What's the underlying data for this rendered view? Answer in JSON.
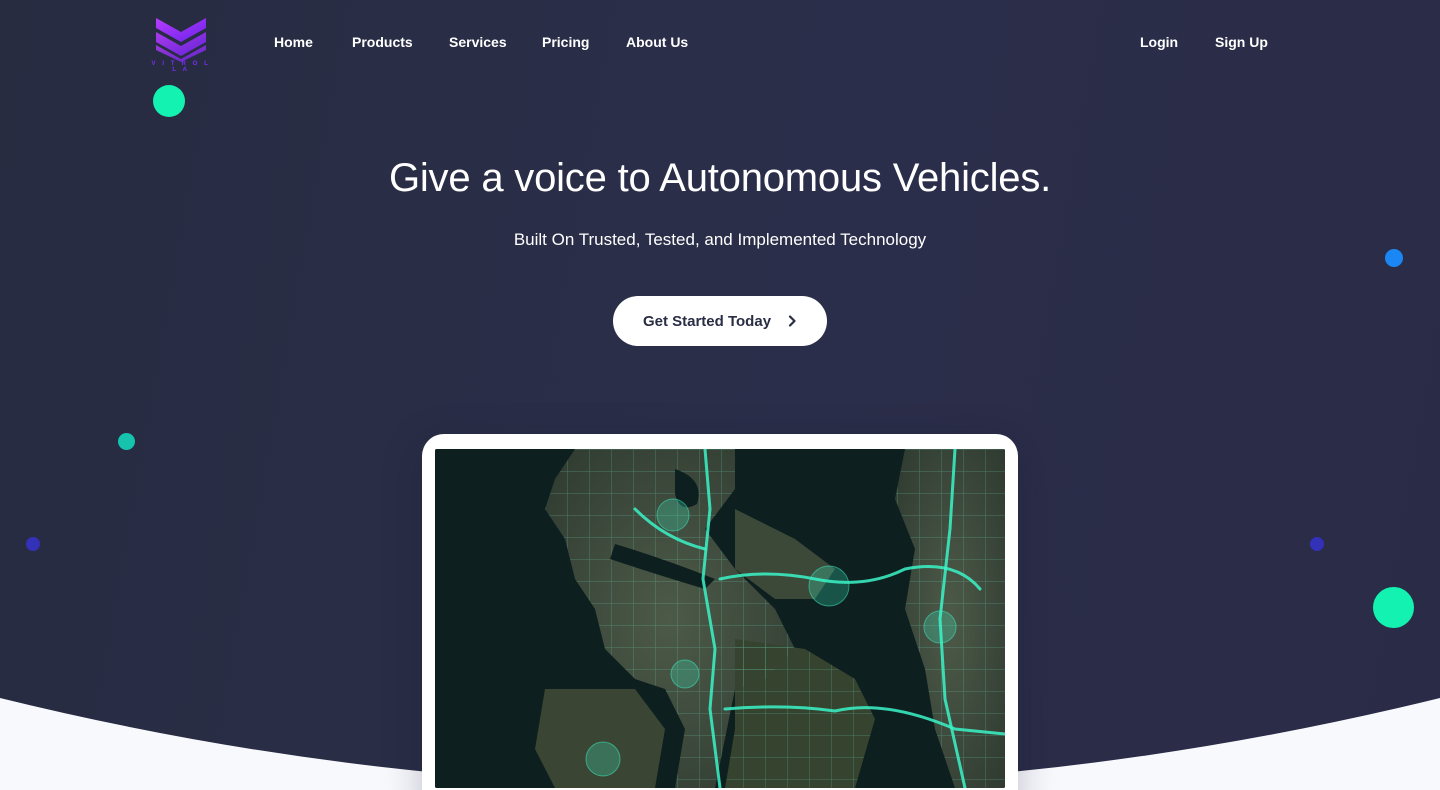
{
  "brand": {
    "name": "V I T R O L L A",
    "accent": "#7b2cf0"
  },
  "nav": {
    "links": [
      "Home",
      "Products",
      "Services",
      "Pricing",
      "About Us"
    ],
    "login": "Login",
    "signup": "Sign Up"
  },
  "hero": {
    "title": "Give a voice to Autonomous Vehicles.",
    "subtitle": "Built On Trusted, Tested, and Implemented Technology",
    "cta_label": "Get Started Today",
    "cta_icon": "chevron-right-icon"
  },
  "colors": {
    "hero_bg": "#282c43",
    "dot_mint": "#13f2b0",
    "dot_teal": "#16c3ad",
    "dot_blue": "#1a87f5",
    "dot_indigo": "#3331b8",
    "map_route": "#3af5c8"
  }
}
